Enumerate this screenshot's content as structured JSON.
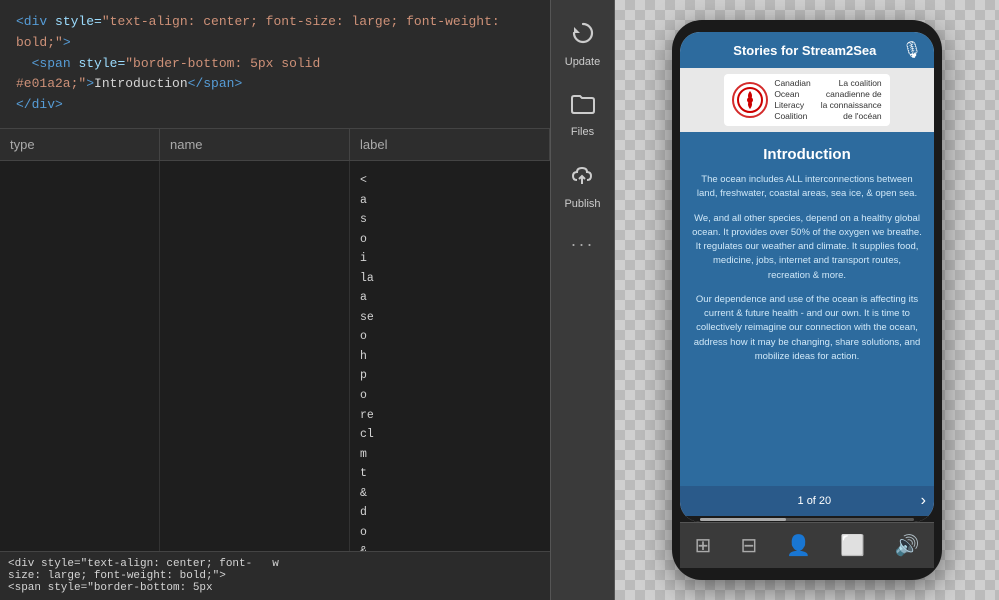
{
  "editor": {
    "top_code_line1": "<div style=\"text-align: center; font-size: large; font-weight: bold;\">",
    "top_code_line2": "  <span style=\"border-bottom: 5px solid #e01a2a;\">Introduction</span>",
    "top_code_line3": "</div>",
    "table_headers": [
      "type",
      "name",
      "label"
    ],
    "overflow_code_lines": [
      "<",
      "a",
      "s",
      "o",
      "i",
      "la",
      "a",
      "se",
      "o",
      "h",
      "p",
      "o",
      "re",
      "cl",
      "m",
      "t",
      "&",
      "d",
      "o",
      "&"
    ],
    "bottom_snippet_1": "<div style=\"text-align: center; font-",
    "bottom_snippet_2": "size: large; font-weight: bold;\">",
    "bottom_snippet_3": "  <span style=\"border-bottom: 5px",
    "col_label_partial": "w"
  },
  "sidebar": {
    "update_label": "Update",
    "files_label": "Files",
    "publish_label": "Publish",
    "dots": "···"
  },
  "phone": {
    "title": "Stories for Stream2Sea",
    "logo_text_left_line1": "Canadian",
    "logo_text_left_line2": "Ocean",
    "logo_text_left_line3": "Literacy",
    "logo_text_left_line4": "Coalition",
    "logo_text_right_line1": "La coalition",
    "logo_text_right_line2": "canadienne de",
    "logo_text_right_line3": "la connaissance",
    "logo_text_right_line4": "de l'océan",
    "intro_title": "Introduction",
    "intro_paragraph1": "The ocean includes ALL interconnections between land, freshwater, coastal areas, sea ice, & open sea.",
    "intro_paragraph2": "We, and all other species, depend on a healthy global ocean. It provides over 50% of the oxygen we breathe. It regulates our weather and climate. It supplies food, medicine, jobs, internet and transport routes, recreation & more.",
    "intro_paragraph3": "Our dependence and use of the ocean is affecting its current & future health - and our own. It is time to collectively reimagine our connection with the ocean, address how it may be changing, share solutions, and mobilize ideas for action.",
    "page_indicator": "1 of 20",
    "nav_arrow": "›"
  },
  "bottom_bar": {
    "icons": [
      "⊞",
      "⊟",
      "👤",
      "⬜",
      "🔊"
    ]
  }
}
